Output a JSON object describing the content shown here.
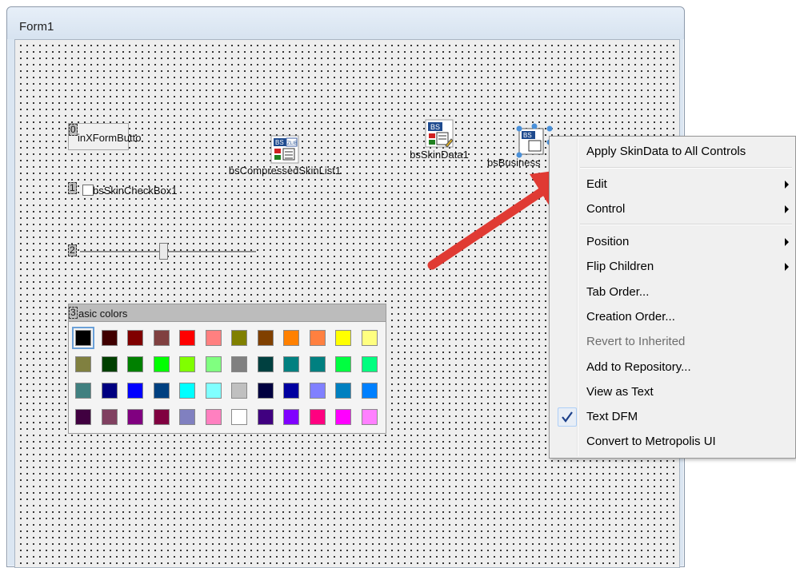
{
  "window": {
    "title": "Form1"
  },
  "form": {
    "button": {
      "tab": "0",
      "label": "inXFormButto"
    },
    "checkbox": {
      "tab": "1",
      "label": "bsSkinCheckBox1"
    },
    "slider": {
      "tab": "2",
      "position": 0.5
    },
    "palette": {
      "tab": "3",
      "title": "asic colors",
      "colors": [
        [
          "#000000",
          "#400000",
          "#800000",
          "#804040",
          "#ff0000",
          "#ff8080",
          "#808000",
          "#804000",
          "#ff8000",
          "#ff8040",
          "#ffff00",
          "#ffff80"
        ],
        [
          "#808040",
          "#004000",
          "#008000",
          "#00ff00",
          "#80ff00",
          "#80ff80",
          "#808080",
          "#004040",
          "#008080",
          "#008080",
          "#00ff40",
          "#00ff80"
        ],
        [
          "#408080",
          "#000080",
          "#0000ff",
          "#004080",
          "#00ffff",
          "#80ffff",
          "#c0c0c0",
          "#000040",
          "#0000a0",
          "#8080ff",
          "#0080c0",
          "#0080ff"
        ],
        [
          "#400040",
          "#804060",
          "#800080",
          "#800040",
          "#8080c0",
          "#ff80c0",
          "#ffffff",
          "#400080",
          "#8000ff",
          "#ff0080",
          "#ff00ff",
          "#ff80ff"
        ]
      ]
    },
    "components": {
      "compressed_list": "bsCompressedSkinList1",
      "skin_data": "bsSkinData1",
      "business": "bsBusiness"
    }
  },
  "context_menu": {
    "items": [
      {
        "label": "Apply SkinData to All Controls"
      },
      {
        "label": "Edit"
      },
      {
        "label": "Control"
      },
      {
        "label": "Position"
      },
      {
        "label": "Flip Children"
      },
      {
        "label": "Tab Order..."
      },
      {
        "label": "Creation Order..."
      },
      {
        "label": "Revert to Inherited"
      },
      {
        "label": "Add to Repository..."
      },
      {
        "label": "View as Text"
      },
      {
        "label": "Text DFM"
      },
      {
        "label": "Convert to Metropolis UI"
      }
    ],
    "checked_item": "Text DFM"
  }
}
